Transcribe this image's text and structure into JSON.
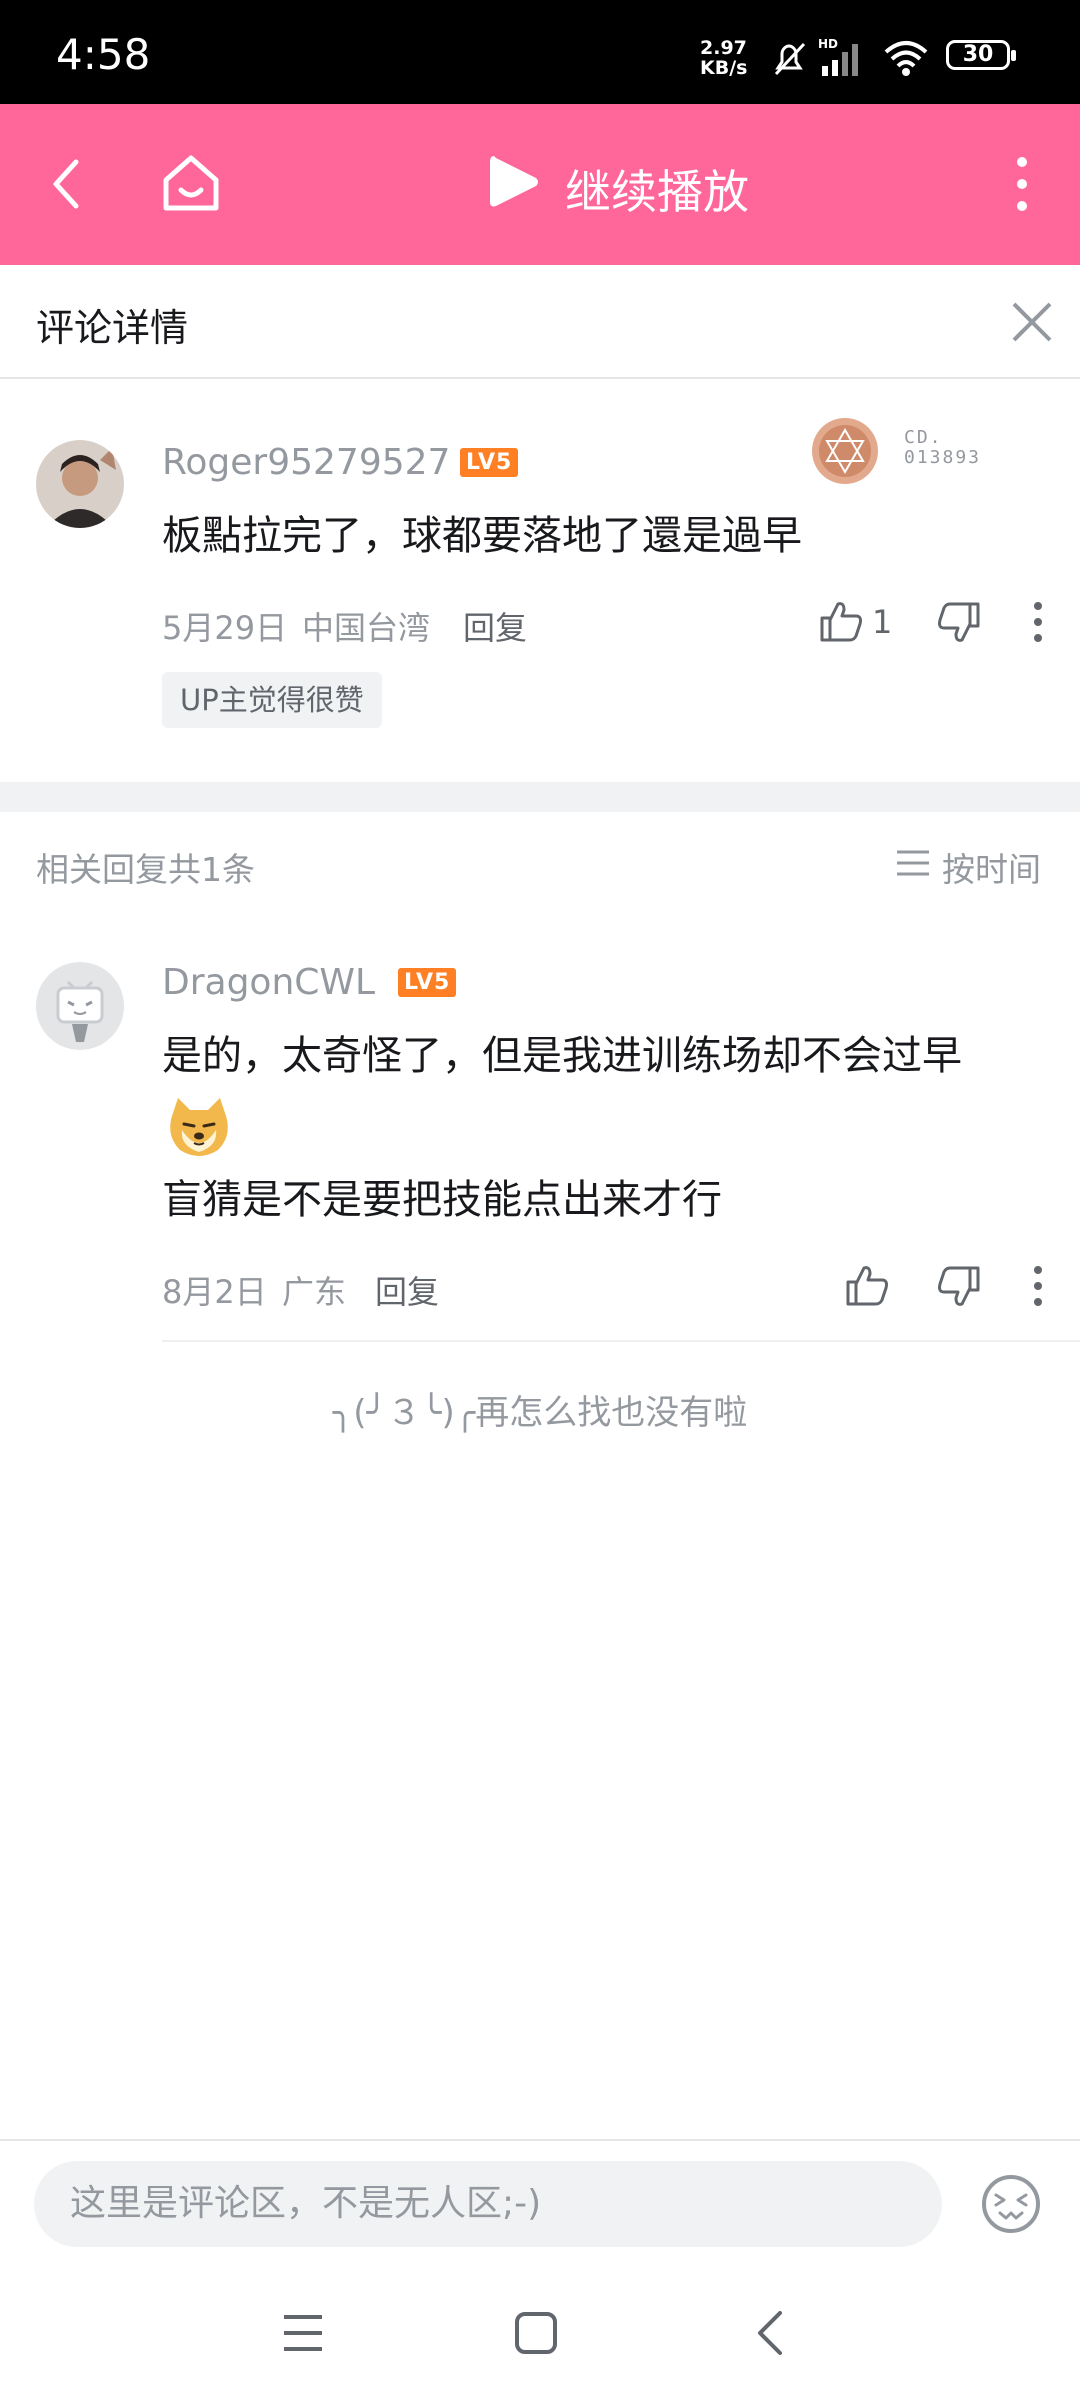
{
  "status_bar": {
    "time": "4:58",
    "speed_value": "2.97",
    "speed_unit": "KB/s",
    "battery": "30"
  },
  "top_bar": {
    "continue_label": "继续播放"
  },
  "header": {
    "title": "评论详情"
  },
  "main_comment": {
    "username": "Roger95279527",
    "level": "LV5",
    "badge_text_1": "CD.",
    "badge_text_2": "013893",
    "content": "板點拉完了，球都要落地了還是過早",
    "date": "5月29日",
    "location": "中国台湾",
    "reply_label": "回复",
    "like_count": "1",
    "tag": "UP主觉得很赞"
  },
  "replies_header": {
    "count_label": "相关回复共1条",
    "sort_label": "按时间"
  },
  "replies": [
    {
      "username": "DragonCWL",
      "level": "LV5",
      "content_line1": "是的，太奇怪了，但是我进训练场却不会过早",
      "content_line2": "盲猜是不是要把技能点出来才行",
      "date": "8月2日",
      "location": "广东",
      "reply_label": "回复"
    }
  ],
  "end_message": "╮(╯３╰)╭再怎么找也没有啦",
  "comment_input": {
    "placeholder": "这里是评论区，不是无人区;-)"
  },
  "colors": {
    "brand_pink": "#ff6699",
    "level_orange": "#ff7f24",
    "grey_text": "#9499a0"
  }
}
